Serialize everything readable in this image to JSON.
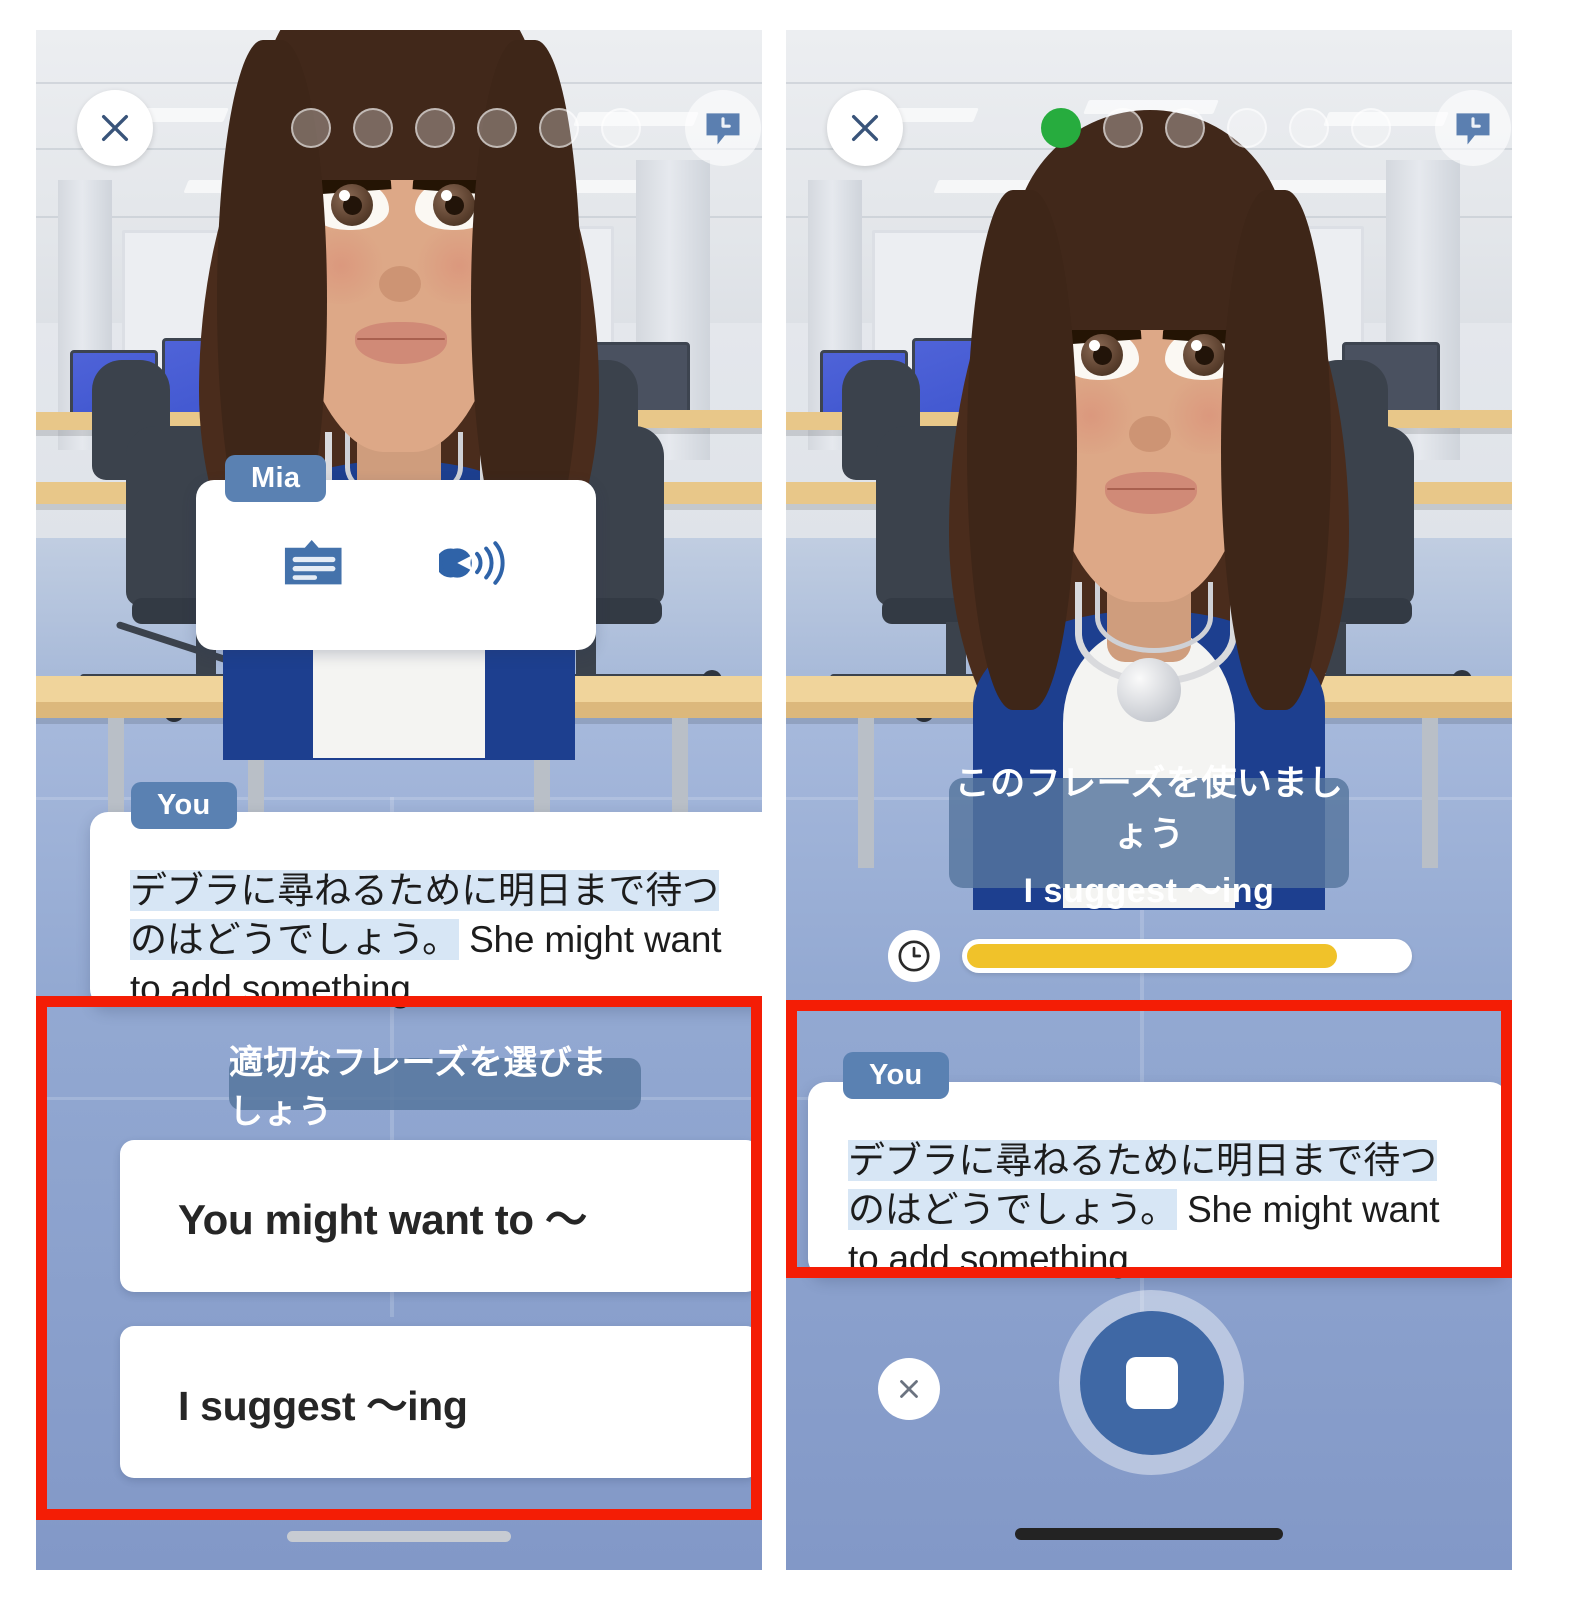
{
  "app": {
    "background_blue": "#7e95c4",
    "accent_blue": "#3f68a5",
    "chip_blue": "#5a81b2",
    "highlight_blue": "#d7e6f5",
    "timer_yellow": "#f0c22a",
    "progress_green": "#27ac3e",
    "annotation_red": "#f41d05"
  },
  "left_panel": {
    "top_bar": {
      "close_label": "×",
      "close_icon": "close-icon",
      "history_icon": "conversation-history-icon",
      "progress_dots": [
        {
          "state": "empty"
        },
        {
          "state": "empty"
        },
        {
          "state": "empty"
        },
        {
          "state": "empty"
        },
        {
          "state": "empty"
        },
        {
          "state": "empty"
        }
      ]
    },
    "speaker_card": {
      "name": "Mia",
      "subtitle_icon": "subtitles-icon",
      "speak_icon": "speaker-voice-icon"
    },
    "user_utterance": {
      "name": "You",
      "highlighted_text": "デブラに尋ねるために明日まで待つのはどうでしょう。",
      "plain_text": "She might want to add something."
    },
    "choice_block": {
      "title": "適切なフレーズを選びましょう",
      "options": [
        {
          "label": "You might want to ～"
        },
        {
          "label": "I suggest ～ing"
        }
      ]
    },
    "home_indicator": "home-indicator"
  },
  "right_panel": {
    "top_bar": {
      "close_label": "×",
      "close_icon": "close-icon",
      "history_icon": "conversation-history-icon",
      "progress_dots": [
        {
          "state": "done"
        },
        {
          "state": "empty"
        },
        {
          "state": "empty"
        },
        {
          "state": "empty"
        },
        {
          "state": "empty"
        },
        {
          "state": "empty"
        }
      ]
    },
    "prompt_banner": {
      "line1": "このフレーズを使いましょう",
      "line2": "I suggest ～ing"
    },
    "timer": {
      "icon": "clock-icon",
      "percent": 84
    },
    "user_utterance": {
      "name": "You",
      "highlighted_text": "デブラに尋ねるために明日まで待つのはどうでしょう。",
      "plain_text": "She might want to add something."
    },
    "record_controls": {
      "cancel_icon": "cancel-recording-icon",
      "stop_icon": "stop-recording-icon"
    },
    "home_indicator": "home-indicator"
  },
  "annotations": [
    {
      "name": "left-choice-area-highlight"
    },
    {
      "name": "right-utterance-highlight"
    }
  ]
}
